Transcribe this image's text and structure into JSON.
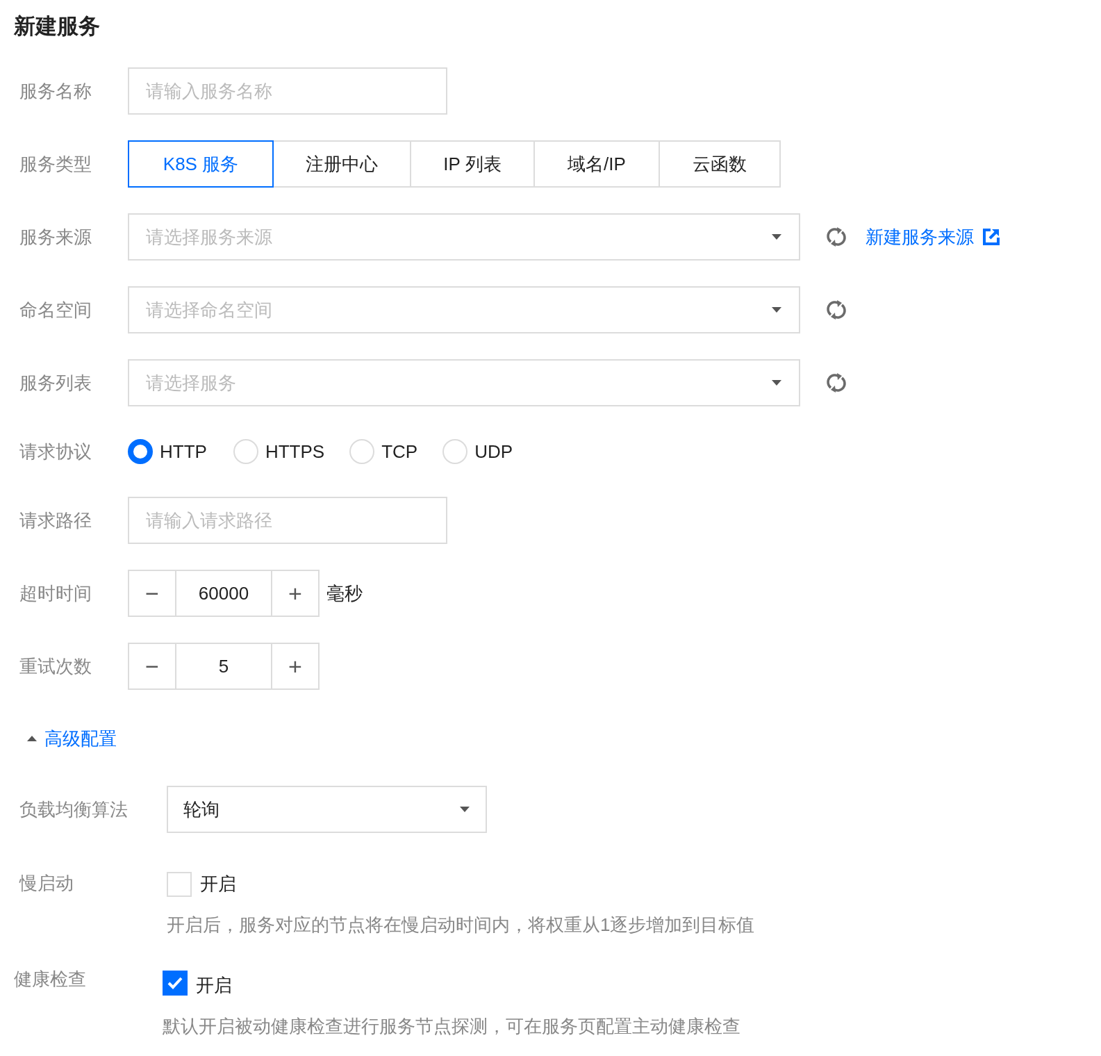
{
  "title": "新建服务",
  "fields": [
    {
      "kind": "text",
      "label": "服务名称",
      "placeholder": "请输入服务名称"
    },
    {
      "kind": "segmented",
      "label": "服务类型",
      "options": [
        {
          "label": "K8S 服务",
          "selected": true
        },
        {
          "label": "注册中心",
          "selected": false
        },
        {
          "label": "IP 列表",
          "selected": false
        },
        {
          "label": "域名/IP",
          "selected": false
        },
        {
          "label": "云函数",
          "selected": false
        }
      ]
    },
    {
      "kind": "select",
      "label": "服务来源",
      "placeholder": "请选择服务来源",
      "refresh": true,
      "link": "新建服务来源"
    },
    {
      "kind": "select",
      "label": "命名空间",
      "placeholder": "请选择命名空间",
      "refresh": true
    },
    {
      "kind": "select",
      "label": "服务列表",
      "placeholder": "请选择服务",
      "refresh": true
    },
    {
      "kind": "radio",
      "label": "请求协议",
      "options": [
        {
          "label": "HTTP",
          "selected": true
        },
        {
          "label": "HTTPS",
          "selected": false
        },
        {
          "label": "TCP",
          "selected": false
        },
        {
          "label": "UDP",
          "selected": false
        }
      ]
    },
    {
      "kind": "text",
      "label": "请求路径",
      "placeholder": "请输入请求路径"
    },
    {
      "kind": "stepper",
      "label": "超时时间",
      "minus": "−",
      "value": "60000",
      "plus": "+",
      "unit": "毫秒"
    },
    {
      "kind": "stepper",
      "label": "重试次数",
      "minus": "−",
      "value": "5",
      "plus": "+"
    }
  ],
  "advanced": {
    "label": "高级配置",
    "expanded": true
  },
  "advanced_fields": [
    {
      "kind": "select",
      "label": "负载均衡算法",
      "value": "轮询"
    },
    {
      "kind": "checkbox",
      "label": "慢启动",
      "option": "开启",
      "checked": false,
      "hint": "开启后，服务对应的节点将在慢启动时间内，将权重从1逐步增加到目标值"
    },
    {
      "kind": "checkbox",
      "label": "健康检查",
      "option": "开启",
      "checked": true,
      "hint": "默认开启被动健康检查进行服务节点探测，可在服务页配置主动健康检查"
    }
  ]
}
